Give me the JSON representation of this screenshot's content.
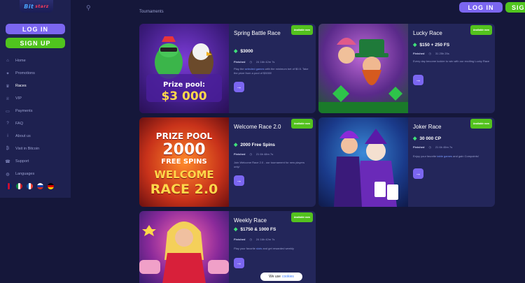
{
  "logo": {
    "text": "Bit",
    "sub": "starz"
  },
  "auth": {
    "login": "LOG IN",
    "signup": "SIGN UP",
    "login_top": "LOG IN",
    "signup_top": "SIGN"
  },
  "section_title": "Tournaments",
  "nav": [
    {
      "label": "Home",
      "icon": "home-icon"
    },
    {
      "label": "Promotions",
      "icon": "gift-icon"
    },
    {
      "label": "Races",
      "icon": "trophy-icon",
      "active": true
    },
    {
      "label": "VIP",
      "icon": "crown-icon"
    },
    {
      "label": "Payments",
      "icon": "card-icon"
    },
    {
      "label": "FAQ",
      "icon": "question-icon"
    },
    {
      "label": "About us",
      "icon": "info-icon"
    },
    {
      "label": "Visit in Bitcoin",
      "icon": "bitcoin-icon"
    },
    {
      "label": "Support",
      "icon": "support-icon"
    },
    {
      "label": "Languages",
      "icon": "globe-icon"
    }
  ],
  "flags": [
    {
      "name": "uk",
      "color": "#c8102e"
    },
    {
      "name": "it",
      "color": "#008c45"
    },
    {
      "name": "fr",
      "color": "#0055a4"
    },
    {
      "name": "ru",
      "color": "#d52b1e"
    },
    {
      "name": "de",
      "color": "#ffce00"
    }
  ],
  "cards": [
    {
      "id": "spring-battle",
      "title": "Spring Battle Race",
      "prize": "$3000",
      "status": "Finished",
      "time": "24 16h 42m 7s",
      "desc_pre": "Play the ",
      "desc_link": "selected games",
      "desc_post": " with the minimum bet of $0.5. Take the prize from a pool of $3000!",
      "badge": "Available now",
      "art_line1": "Prize pool:",
      "art_line2": "$3 000"
    },
    {
      "id": "lucky-race",
      "title": "Lucky Race",
      "prize": "$150 + 250 FS",
      "status": "Finished",
      "time": "31 25h 25s",
      "desc_pre": "Every day become luckier to win with our exciting Lucky Race",
      "desc_link": "",
      "desc_post": "",
      "badge": "Available now"
    },
    {
      "id": "welcome-race",
      "title": "Welcome Race 2.0",
      "prize": "2000 Free Spins",
      "status": "Finished",
      "time": "21 6h 48m 7s",
      "desc_pre": "Join Welcome Race 2.0 - our tournament for new players only!",
      "desc_link": "",
      "desc_post": "",
      "badge": "Available now",
      "art_line1": "PRIZE POOL",
      "art_line2": "2000",
      "art_line3": "FREE SPINS",
      "art_line4": "WELCOME",
      "art_line5": "RACE 2.0"
    },
    {
      "id": "joker-race",
      "title": "Joker Race",
      "prize": "30 000 CP",
      "status": "Finished",
      "time": "21 6h 45m 7s",
      "desc_pre": "Enjoy your favorite ",
      "desc_link": "table games",
      "desc_post": " and gain Compoints!",
      "badge": "Available now"
    },
    {
      "id": "weekly-race",
      "title": "Weekly Race",
      "prize": "$1750 & 1000 FS",
      "status": "Finished",
      "time": "24 16h 42m 7s",
      "desc_pre": "Play your favorite ",
      "desc_link": "slots",
      "desc_post": " and get rewarded weekly",
      "badge": "Available now"
    }
  ],
  "cookie": {
    "pre": "We use",
    "link": "cookies"
  },
  "colors": {
    "bg": "#15173a",
    "card": "#23265a",
    "accent": "#7b66f0",
    "green": "#50c41e"
  }
}
